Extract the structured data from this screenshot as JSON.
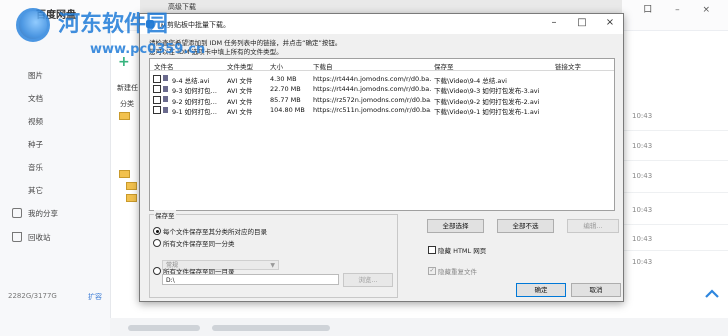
{
  "netdisk": {
    "app_title": "百度网盘",
    "behind_window_title": "高级下载",
    "new_task": "新建任",
    "category_label": "分类",
    "sidebar": [
      {
        "label": "图片"
      },
      {
        "label": "文档"
      },
      {
        "label": "视频"
      },
      {
        "label": "种子"
      },
      {
        "label": "音乐"
      },
      {
        "label": "其它"
      },
      {
        "label": "我的分享",
        "icon": "share-icon"
      },
      {
        "label": "回收站",
        "icon": "recycle-bin-icon"
      }
    ],
    "storage": "2282G/3177G",
    "expand_label": "扩容",
    "times": [
      "10:43",
      "10:43",
      "10:43",
      "10:43",
      "10:43",
      "10:43"
    ],
    "controls": "口 – ×"
  },
  "watermark": {
    "site": "河东软件园",
    "url": "www.pc0359.cn",
    "plus": "+"
  },
  "dialog": {
    "title": "从剪贴板中批量下载。",
    "controls": {
      "minimize": "–",
      "maximize": "□",
      "close": "×"
    },
    "instructions": [
      "请检查您希望添加到 IDM 任务列表中的链接，并点击“确定”按钮。",
      "您可以在 IDM 选项卡中填上所有的文件类型。"
    ],
    "columns": {
      "name": "文件名",
      "type": "文件类型",
      "size": "大小",
      "url": "下载自",
      "save": "保存至",
      "link_text": "链接文字"
    },
    "files": [
      {
        "name": "9-4 总结.avi",
        "type": "AVI 文件",
        "size": "4.30 MB",
        "url": "https://rt444n.jomodns.com/r/d0.ba...",
        "save": "下载\\Video\\9-4 总结.avi",
        "checked": false
      },
      {
        "name": "9-3 如何打包...",
        "type": "AVI 文件",
        "size": "22.70 MB",
        "url": "https://rt444n.jomodns.com/r/d0.ba...",
        "save": "下载\\Video\\9-3 如何打包发布-3.avi",
        "checked": false
      },
      {
        "name": "9-2 如何打包...",
        "type": "AVI 文件",
        "size": "85.77 MB",
        "url": "https://rz572n.jomodns.com/r/d0.ba...",
        "save": "下载\\Video\\9-2 如何打包发布-2.avi",
        "checked": false
      },
      {
        "name": "9-1 如何打包...",
        "type": "AVI 文件",
        "size": "104.80 MB",
        "url": "https://rc511n.jomodns.com/r/d0.ba...",
        "save": "下载\\Video\\9-1 如何打包发布-1.avi",
        "checked": false
      }
    ],
    "select_all": "全部选择",
    "select_none": "全部不选",
    "edit": "编辑...",
    "save_group": {
      "legend": "保存至",
      "opt_category_dir": "每个文件保存至其分类所对应的目录",
      "opt_same_category": "所有文件保存至同一分类",
      "category_value": "常规",
      "opt_same_dir": "所有文件保存至同一目录",
      "folder_value": "D:\\",
      "browse": "浏览...",
      "selected": "opt_category_dir"
    },
    "hide_html": "隐藏 HTML 网页",
    "hide_html_checked": false,
    "hide_duplicates": "隐藏重复文件",
    "hide_duplicates_checked": true,
    "ok": "确定",
    "cancel": "取消"
  },
  "colors": {
    "accent": "#0078d7",
    "watermark": "#1f7bd8",
    "dialog_bg": "#f0f0f0",
    "netdisk_link": "#3a7bd5"
  }
}
